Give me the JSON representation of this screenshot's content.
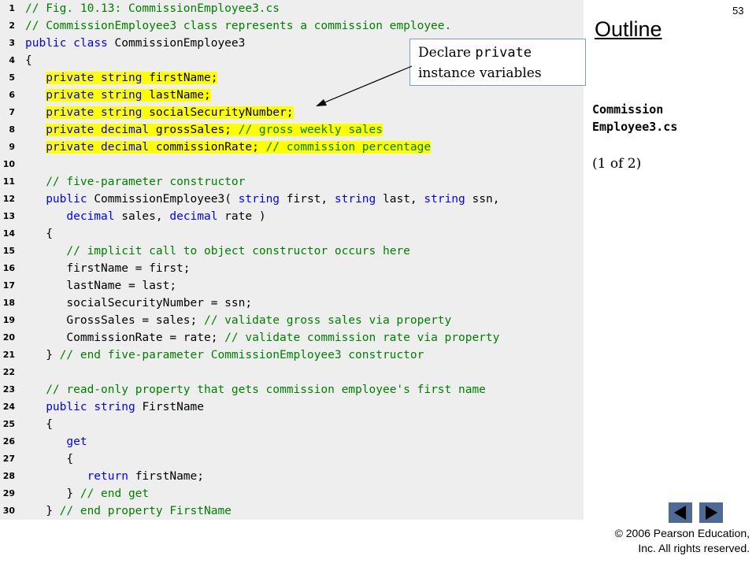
{
  "slide_number": "53",
  "outline_title": "Outline",
  "file_label_line1": "Commission",
  "file_label_line2": "Employee3.cs",
  "page_indicator": "(1 of 2)",
  "callout": {
    "text_before": "Declare",
    "keyword": "private",
    "text_after": "instance variables"
  },
  "copyright_line1": "© 2006 Pearson Education,",
  "copyright_line2": "Inc.  All rights reserved.",
  "nav": {
    "prev_icon": "triangle-left",
    "next_icon": "triangle-right"
  },
  "colors": {
    "keyword": "#0000ff",
    "comment": "#008000",
    "highlight": "#ffff00",
    "panel": "#eeeeee"
  },
  "code_lines": [
    {
      "n": "1",
      "hl": false,
      "segs": [
        [
          "c",
          "// Fig. 10.13: CommissionEmployee3.cs"
        ]
      ]
    },
    {
      "n": "2",
      "hl": false,
      "segs": [
        [
          "c",
          "// CommissionEmployee3 class represents a commission employee."
        ]
      ]
    },
    {
      "n": "3",
      "hl": false,
      "segs": [
        [
          "k",
          "public"
        ],
        [
          "t",
          " "
        ],
        [
          "k",
          "class"
        ],
        [
          "t",
          " CommissionEmployee3"
        ]
      ]
    },
    {
      "n": "4",
      "hl": false,
      "segs": [
        [
          "t",
          "{"
        ]
      ]
    },
    {
      "n": "5",
      "hl": true,
      "segs": [
        [
          "t",
          "   "
        ],
        [
          "k",
          "private"
        ],
        [
          "t",
          " "
        ],
        [
          "k",
          "string"
        ],
        [
          "t",
          " firstName;"
        ]
      ]
    },
    {
      "n": "6",
      "hl": true,
      "segs": [
        [
          "t",
          "   "
        ],
        [
          "k",
          "private"
        ],
        [
          "t",
          " "
        ],
        [
          "k",
          "string"
        ],
        [
          "t",
          " lastName;"
        ]
      ]
    },
    {
      "n": "7",
      "hl": true,
      "segs": [
        [
          "t",
          "   "
        ],
        [
          "k",
          "private"
        ],
        [
          "t",
          " "
        ],
        [
          "k",
          "string"
        ],
        [
          "t",
          " socialSecurityNumber;"
        ]
      ]
    },
    {
      "n": "8",
      "hl": true,
      "segs": [
        [
          "t",
          "   "
        ],
        [
          "k",
          "private"
        ],
        [
          "t",
          " "
        ],
        [
          "k",
          "decimal"
        ],
        [
          "t",
          " grossSales; "
        ],
        [
          "c",
          "// gross weekly sales"
        ]
      ]
    },
    {
      "n": "9",
      "hl": true,
      "segs": [
        [
          "t",
          "   "
        ],
        [
          "k",
          "private"
        ],
        [
          "t",
          " "
        ],
        [
          "k",
          "decimal"
        ],
        [
          "t",
          " commissionRate; "
        ],
        [
          "c",
          "// commission percentage"
        ]
      ]
    },
    {
      "n": "10",
      "hl": false,
      "segs": [
        [
          "t",
          ""
        ]
      ]
    },
    {
      "n": "11",
      "hl": false,
      "segs": [
        [
          "t",
          "   "
        ],
        [
          "c",
          "// five-parameter constructor"
        ]
      ]
    },
    {
      "n": "12",
      "hl": false,
      "segs": [
        [
          "t",
          "   "
        ],
        [
          "k",
          "public"
        ],
        [
          "t",
          " CommissionEmployee3( "
        ],
        [
          "k",
          "string"
        ],
        [
          "t",
          " first, "
        ],
        [
          "k",
          "string"
        ],
        [
          "t",
          " last, "
        ],
        [
          "k",
          "string"
        ],
        [
          "t",
          " ssn,"
        ]
      ]
    },
    {
      "n": "13",
      "hl": false,
      "segs": [
        [
          "t",
          "      "
        ],
        [
          "k",
          "decimal"
        ],
        [
          "t",
          " sales, "
        ],
        [
          "k",
          "decimal"
        ],
        [
          "t",
          " rate )"
        ]
      ]
    },
    {
      "n": "14",
      "hl": false,
      "segs": [
        [
          "t",
          "   {"
        ]
      ]
    },
    {
      "n": "15",
      "hl": false,
      "segs": [
        [
          "t",
          "      "
        ],
        [
          "c",
          "// implicit call to object constructor occurs here"
        ]
      ]
    },
    {
      "n": "16",
      "hl": false,
      "segs": [
        [
          "t",
          "      firstName = first;"
        ]
      ]
    },
    {
      "n": "17",
      "hl": false,
      "segs": [
        [
          "t",
          "      lastName = last;"
        ]
      ]
    },
    {
      "n": "18",
      "hl": false,
      "segs": [
        [
          "t",
          "      socialSecurityNumber = ssn;"
        ]
      ]
    },
    {
      "n": "19",
      "hl": false,
      "segs": [
        [
          "t",
          "      GrossSales = sales; "
        ],
        [
          "c",
          "// validate gross sales via property"
        ]
      ]
    },
    {
      "n": "20",
      "hl": false,
      "segs": [
        [
          "t",
          "      CommissionRate = rate; "
        ],
        [
          "c",
          "// validate commission rate via property"
        ]
      ]
    },
    {
      "n": "21",
      "hl": false,
      "segs": [
        [
          "t",
          "   } "
        ],
        [
          "c",
          "// end five-parameter CommissionEmployee3 constructor"
        ]
      ]
    },
    {
      "n": "22",
      "hl": false,
      "segs": [
        [
          "t",
          ""
        ]
      ]
    },
    {
      "n": "23",
      "hl": false,
      "segs": [
        [
          "t",
          "   "
        ],
        [
          "c",
          "// read-only property that gets commission employee's first name"
        ]
      ]
    },
    {
      "n": "24",
      "hl": false,
      "segs": [
        [
          "t",
          "   "
        ],
        [
          "k",
          "public"
        ],
        [
          "t",
          " "
        ],
        [
          "k",
          "string"
        ],
        [
          "t",
          " FirstName"
        ]
      ]
    },
    {
      "n": "25",
      "hl": false,
      "segs": [
        [
          "t",
          "   {"
        ]
      ]
    },
    {
      "n": "26",
      "hl": false,
      "segs": [
        [
          "t",
          "      "
        ],
        [
          "k",
          "get"
        ]
      ]
    },
    {
      "n": "27",
      "hl": false,
      "segs": [
        [
          "t",
          "      {"
        ]
      ]
    },
    {
      "n": "28",
      "hl": false,
      "segs": [
        [
          "t",
          "         "
        ],
        [
          "k",
          "return"
        ],
        [
          "t",
          " firstName;"
        ]
      ]
    },
    {
      "n": "29",
      "hl": false,
      "segs": [
        [
          "t",
          "      } "
        ],
        [
          "c",
          "// end get"
        ]
      ]
    },
    {
      "n": "30",
      "hl": false,
      "segs": [
        [
          "t",
          "   } "
        ],
        [
          "c",
          "// end property FirstName"
        ]
      ]
    }
  ]
}
